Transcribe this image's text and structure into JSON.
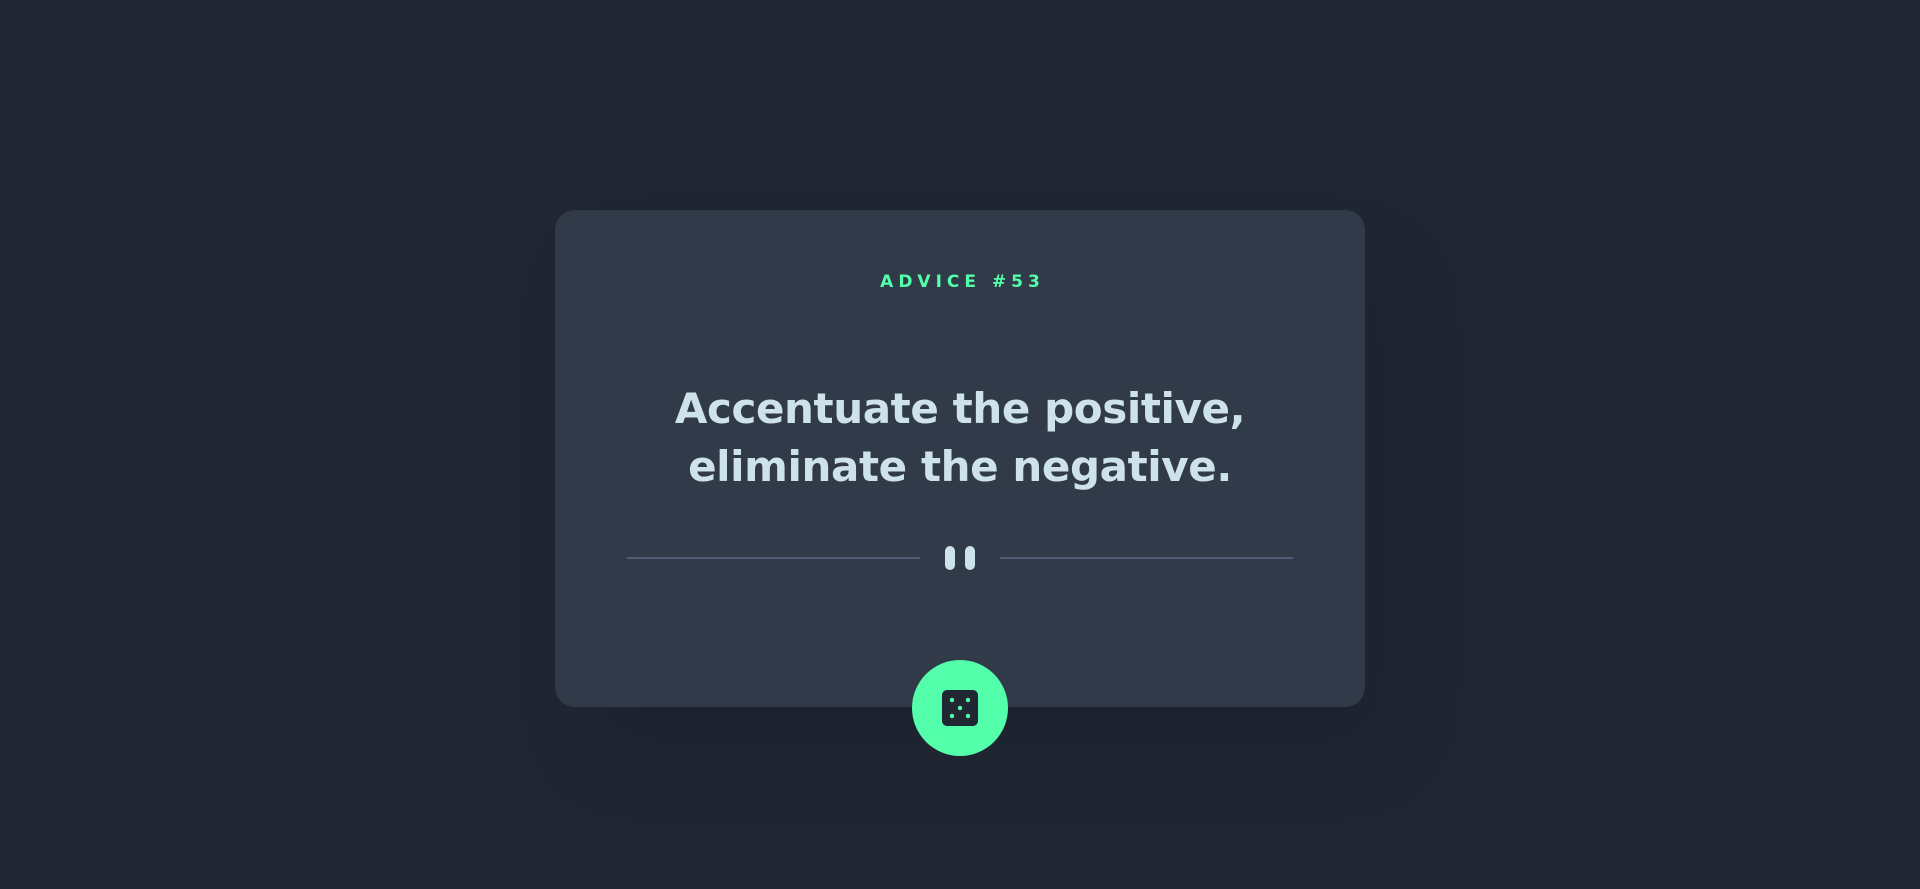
{
  "card": {
    "label_prefix": "ADVICE #",
    "advice_number": "53",
    "quote_line1": "Accentuate the positive,",
    "quote_line2": "eliminate the negative."
  },
  "icons": {
    "divider": "pause-icon",
    "button": "dice-icon"
  },
  "colors": {
    "background": "#202733",
    "card": "#313a48",
    "accent": "#53ffaa",
    "text": "#cee3e9",
    "divider_line": "#4f5d74"
  }
}
